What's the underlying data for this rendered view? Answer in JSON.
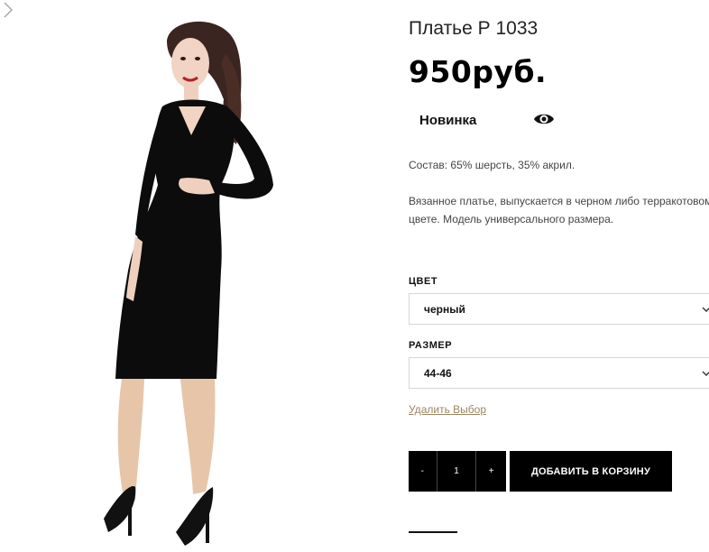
{
  "gallery": {
    "image_alt": "woman-in-black-knit-dress",
    "next_icon": "chevron-right-icon"
  },
  "product": {
    "title": "Платье Р 1033",
    "price": "950руб.",
    "badge": "Новинка",
    "quick_view_icon": "eye-icon",
    "composition": "Состав: 65% шерсть, 35% акрил.",
    "description": "Вязанное платье, выпускается в черном либо терракотовом цвете. Модель универсального размера."
  },
  "options": {
    "color_label": "ЦВЕТ",
    "color_value": "черный",
    "size_label": "РАЗМЕР",
    "size_value": "44-46",
    "reset_label": "Удалить Выбор"
  },
  "cart": {
    "minus": "-",
    "quantity": "1",
    "plus": "+",
    "add_label": "ДОБАВИТЬ В КОРЗИНУ"
  },
  "colors": {
    "accent_link": "#9b8660",
    "button_bg": "#000000"
  }
}
